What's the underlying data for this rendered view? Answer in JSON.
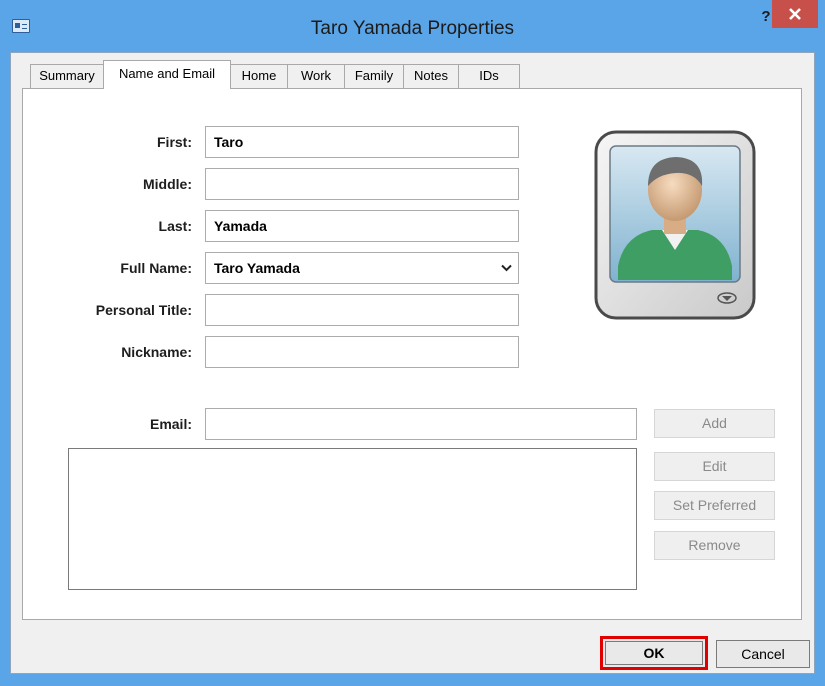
{
  "window": {
    "title": "Taro Yamada Properties",
    "help": "?"
  },
  "tabs": [
    "Summary",
    "Name and Email",
    "Home",
    "Work",
    "Family",
    "Notes",
    "IDs"
  ],
  "form": {
    "first": {
      "label": "First:",
      "value": "Taro"
    },
    "middle": {
      "label": "Middle:",
      "value": ""
    },
    "last": {
      "label": "Last:",
      "value": "Yamada"
    },
    "fullname": {
      "label": "Full Name:",
      "value": "Taro Yamada"
    },
    "title": {
      "label": "Personal Title:",
      "value": ""
    },
    "nickname": {
      "label": "Nickname:",
      "value": ""
    },
    "email": {
      "label": "Email:",
      "value": ""
    }
  },
  "side_buttons": {
    "add": "Add",
    "edit": "Edit",
    "set_preferred": "Set Preferred",
    "remove": "Remove"
  },
  "footer": {
    "ok": "OK",
    "cancel": "Cancel"
  },
  "colors": {
    "titlebar": "#5aa4e8",
    "close": "#c7504a",
    "highlight": "#e00000"
  }
}
